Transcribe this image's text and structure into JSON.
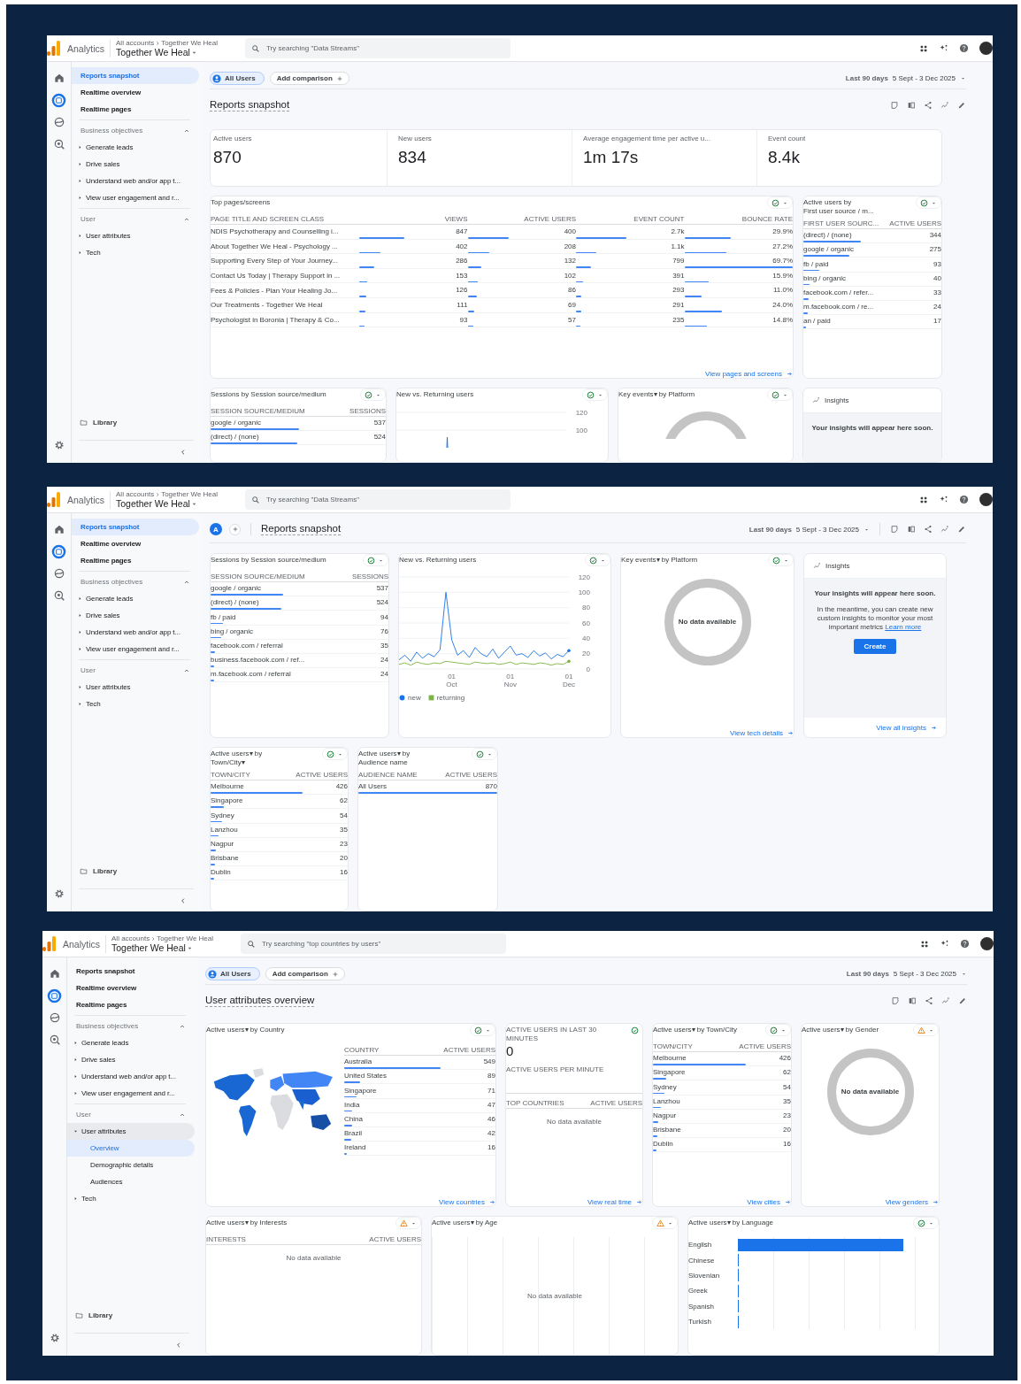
{
  "screens": [
    {
      "topbar": {
        "product": "Analytics",
        "breadcrumb": [
          "All accounts",
          "Together We Heal"
        ],
        "property": "Together We Heal",
        "search_placeholder": "Try searching \"Data Streams\""
      },
      "rail": [
        {
          "kind": "home",
          "selected": false
        },
        {
          "kind": "reports",
          "selected": true
        },
        {
          "kind": "explore",
          "selected": false
        },
        {
          "kind": "advertising",
          "selected": false
        }
      ],
      "nav": {
        "items": [
          {
            "label": "Reports snapshot",
            "selected": true
          },
          {
            "label": "Realtime overview",
            "selected": false
          },
          {
            "label": "Realtime pages",
            "selected": false
          }
        ],
        "sections": [
          {
            "title": "Business objectives",
            "expanded": true,
            "items": [
              {
                "label": "Generate leads",
                "expanded": false
              },
              {
                "label": "Drive sales",
                "expanded": false
              },
              {
                "label": "Understand web and/or app t...",
                "expanded": false
              },
              {
                "label": "View user engagement and r...",
                "expanded": false
              }
            ]
          },
          {
            "title": "User",
            "expanded": true,
            "items": [
              {
                "label": "User attributes",
                "expanded": false
              },
              {
                "label": "Tech",
                "expanded": false
              }
            ]
          }
        ],
        "library": "Library"
      },
      "header": {
        "kind": "full",
        "segment": "All Users",
        "comparison": "Add comparison",
        "title": "Reports snapshot",
        "date_label": "Last 90 days",
        "date_range": "5 Sept - 3 Dec 2025"
      },
      "rows": [
        {
          "cards": [
            {
              "kind": "kpis",
              "metrics": [
                {
                  "label": "Active users",
                  "value": "870"
                },
                {
                  "label": "New users",
                  "value": "834"
                },
                {
                  "label": "Average engagement time per active u...",
                  "value": "1m 17s"
                },
                {
                  "label": "Event count",
                  "value": "8.4k"
                }
              ]
            }
          ]
        },
        {
          "cards": [
            {
              "kind": "table",
              "title": "Top pages/screens",
              "status": {
                "kind": "ok",
                "menu": true
              },
              "columns": [
                "PAGE TITLE AND SCREEN CLASS",
                "VIEWS",
                "ACTIVE USERS",
                "EVENT COUNT",
                "BOUNCE RATE"
              ],
              "rows": [
                [
                  "NDIS Psychotherapy and Counselling i...",
                  "847",
                  "400",
                  "2.7k",
                  "29.9%"
                ],
                [
                  "About Together We Heal - Psychology ...",
                  "402",
                  "208",
                  "1.1k",
                  "27.2%"
                ],
                [
                  "Supporting Every Step of Your Journey...",
                  "286",
                  "132",
                  "799",
                  "69.7%"
                ],
                [
                  "Contact Us Today | Therapy Support in ...",
                  "153",
                  "102",
                  "391",
                  "15.9%"
                ],
                [
                  "Fees & Policies - Plan Your Healing Jo...",
                  "126",
                  "86",
                  "293",
                  "11.0%"
                ],
                [
                  "Our Treatments - Together We Heal",
                  "111",
                  "69",
                  "291",
                  "24.0%"
                ],
                [
                  "Psychologist in Boronia | Therapy & Co...",
                  "93",
                  "57",
                  "235",
                  "14.8%"
                ]
              ],
              "link": "View pages and screens"
            },
            {
              "kind": "table",
              "title": "Active users by\nFirst user source / m...",
              "status": {
                "kind": "ok",
                "menu": true
              },
              "columns": [
                "FIRST USER SOURC...",
                "ACTIVE USERS"
              ],
              "rows": [
                [
                  "(direct) / (none)",
                  "344"
                ],
                [
                  "google / organic",
                  "275"
                ],
                [
                  "fb / paid",
                  "93"
                ],
                [
                  "bing / organic",
                  "40"
                ],
                [
                  "facebook.com / refer...",
                  "33"
                ],
                [
                  "m.facebook.com / re...",
                  "24"
                ],
                [
                  "an / paid",
                  "17"
                ]
              ]
            }
          ]
        },
        {
          "cards": [
            {
              "kind": "table",
              "title": "Sessions by Session source/medium",
              "status": {
                "kind": "ok",
                "menu": true
              },
              "columns": [
                "SESSION SOURCE/MEDIUM",
                "SESSIONS"
              ],
              "rows": [
                [
                  "google / organic",
                  "537"
                ],
                [
                  "(direct) / (none)",
                  "524"
                ]
              ]
            },
            {
              "kind": "line_partial",
              "title": "New vs. Returning users",
              "status": {
                "kind": "ok",
                "menu": true
              },
              "y_ticks": [
                "120",
                "100"
              ]
            },
            {
              "kind": "donut",
              "title": "Key events▾ by Platform",
              "status": {
                "kind": "ok",
                "menu": true
              }
            },
            {
              "kind": "insights",
              "title": "Insights",
              "headline": "Your insights will appear here soon."
            }
          ]
        }
      ]
    },
    {
      "topbar": {
        "product": "Analytics",
        "breadcrumb": [
          "All accounts",
          "Together We Heal"
        ],
        "property": "Together We Heal",
        "search_placeholder": "Try searching \"Data Streams\""
      },
      "rail": [
        {
          "kind": "home",
          "selected": false
        },
        {
          "kind": "reports",
          "selected": true
        },
        {
          "kind": "explore",
          "selected": false
        },
        {
          "kind": "advertising",
          "selected": false
        }
      ],
      "nav": {
        "items": [
          {
            "label": "Reports snapshot",
            "selected": true
          },
          {
            "label": "Realtime overview",
            "selected": false
          },
          {
            "label": "Realtime pages",
            "selected": false
          }
        ],
        "sections": [
          {
            "title": "Business objectives",
            "expanded": true,
            "items": [
              {
                "label": "Generate leads",
                "expanded": false
              },
              {
                "label": "Drive sales",
                "expanded": false
              },
              {
                "label": "Understand web and/or app t...",
                "expanded": false
              },
              {
                "label": "View user engagement and r...",
                "expanded": false
              }
            ]
          },
          {
            "title": "User",
            "expanded": true,
            "items": [
              {
                "label": "User attributes",
                "expanded": false
              },
              {
                "label": "Tech",
                "expanded": false
              }
            ]
          }
        ],
        "library": "Library"
      },
      "header": {
        "kind": "compact",
        "segment_badge": "A",
        "title": "Reports snapshot",
        "date_label": "Last 90 days",
        "date_range": "5 Sept - 3 Dec 2025"
      },
      "rows": [
        {
          "cards": [
            {
              "kind": "table",
              "title": "Sessions by Session source/medium",
              "status": {
                "kind": "ok",
                "menu": true
              },
              "columns": [
                "SESSION SOURCE/MEDIUM",
                "SESSIONS"
              ],
              "rows": [
                [
                  "google / organic",
                  "537"
                ],
                [
                  "(direct) / (none)",
                  "524"
                ],
                [
                  "fb / paid",
                  "94"
                ],
                [
                  "bing / organic",
                  "76"
                ],
                [
                  "facebook.com / referral",
                  "35"
                ],
                [
                  "business.facebook.com / ref...",
                  "24"
                ],
                [
                  "m.facebook.com / referral",
                  "24"
                ]
              ]
            },
            {
              "kind": "line_chart",
              "title": "New vs. Returning users",
              "status": {
                "kind": "ok",
                "menu": true
              },
              "chart_data": {
                "type": "line",
                "categories": [
                  null,
                  null,
                  null,
                  null,
                  null,
                  null,
                  null,
                  null,
                  null,
                  "01 Oct",
                  null,
                  null,
                  null,
                  null,
                  null,
                  null,
                  null,
                  null,
                  null,
                  "01 Nov",
                  null,
                  null,
                  null,
                  null,
                  null,
                  null,
                  null,
                  null,
                  null,
                  "01 Dec"
                ],
                "ylim": [
                  0,
                  120
                ],
                "yticks": [
                  0,
                  20,
                  40,
                  60,
                  80,
                  100,
                  120
                ],
                "grid": true,
                "series": [
                  {
                    "name": "new",
                    "color": "#1a73e8",
                    "values": [
                      12,
                      18,
                      10,
                      22,
                      14,
                      20,
                      16,
                      25,
                      100,
                      38,
                      18,
                      24,
                      15,
                      28,
                      20,
                      16,
                      26,
                      14,
                      22,
                      30,
                      18,
                      20,
                      15,
                      24,
                      17,
                      21,
                      13,
                      19,
                      16,
                      24
                    ]
                  },
                  {
                    "name": "returning",
                    "color": "#7cb342",
                    "values": [
                      6,
                      8,
                      5,
                      9,
                      7,
                      6,
                      8,
                      7,
                      10,
                      9,
                      8,
                      7,
                      6,
                      9,
                      8,
                      7,
                      8,
                      6,
                      7,
                      9,
                      6,
                      8,
                      7,
                      6,
                      8,
                      7,
                      5,
                      7,
                      6,
                      10
                    ]
                  }
                ]
              }
            },
            {
              "kind": "donut",
              "title": "Key events▾ by Platform",
              "status": {
                "kind": "ok",
                "menu": true
              },
              "empty_text": "No data available",
              "link": "View tech details"
            },
            {
              "kind": "insights",
              "title": "Insights",
              "headline": "Your insights will appear here soon.",
              "body": "In the meantime, you can create new custom insights to monitor your most important metrics",
              "learn_more": "Learn more",
              "button": "Create",
              "link": "View all insights"
            }
          ]
        },
        {
          "cards": [
            {
              "kind": "table",
              "title": "Active users▾ by\nTown/City▾",
              "status": {
                "kind": "ok",
                "menu": true
              },
              "columns": [
                "TOWN/CITY",
                "ACTIVE USERS"
              ],
              "rows": [
                [
                  "Melbourne",
                  "426"
                ],
                [
                  "Singapore",
                  "62"
                ],
                [
                  "Sydney",
                  "54"
                ],
                [
                  "Lanzhou",
                  "35"
                ],
                [
                  "Nagpur",
                  "23"
                ],
                [
                  "Brisbane",
                  "20"
                ],
                [
                  "Dublin",
                  "16"
                ]
              ]
            },
            {
              "kind": "table",
              "title": "Active users▾ by\nAudience name",
              "status": {
                "kind": "ok",
                "menu": true
              },
              "columns": [
                "AUDIENCE NAME",
                "ACTIVE USERS"
              ],
              "rows": [
                [
                  "All Users",
                  "870"
                ]
              ]
            }
          ]
        }
      ]
    },
    {
      "topbar": {
        "product": "Analytics",
        "breadcrumb": [
          "All accounts",
          "Together We Heal"
        ],
        "property": "Together We Heal",
        "search_placeholder": "Try searching \"top countries by users\""
      },
      "rail": [
        {
          "kind": "home",
          "selected": false
        },
        {
          "kind": "reports",
          "selected": true
        },
        {
          "kind": "explore",
          "selected": false
        },
        {
          "kind": "advertising",
          "selected": false
        }
      ],
      "nav": {
        "items": [
          {
            "label": "Reports snapshot",
            "selected": false
          },
          {
            "label": "Realtime overview",
            "selected": false
          },
          {
            "label": "Realtime pages",
            "selected": false
          }
        ],
        "sections": [
          {
            "title": "Business objectives",
            "expanded": true,
            "items": [
              {
                "label": "Generate leads",
                "expanded": false
              },
              {
                "label": "Drive sales",
                "expanded": false
              },
              {
                "label": "Understand web and/or app t...",
                "expanded": false
              },
              {
                "label": "View user engagement and r...",
                "expanded": false
              }
            ]
          },
          {
            "title": "User",
            "expanded": true,
            "items": [
              {
                "label": "User attributes",
                "expanded": true,
                "children": [
                  {
                    "label": "Overview",
                    "selected": true
                  },
                  {
                    "label": "Demographic details",
                    "selected": false
                  },
                  {
                    "label": "Audiences",
                    "selected": false
                  }
                ]
              },
              {
                "label": "Tech",
                "expanded": false
              }
            ]
          }
        ],
        "library": "Library"
      },
      "header": {
        "kind": "full",
        "segment": "All Users",
        "comparison": "Add comparison",
        "title": "User attributes overview",
        "date_label": "Last 90 days",
        "date_range": "5 Sept - 3 Dec 2025"
      },
      "rows": [
        {
          "cards": [
            {
              "kind": "map_table",
              "title": "Active users▾ by Country",
              "status": {
                "kind": "ok",
                "menu": true
              },
              "columns": [
                "COUNTRY",
                "ACTIVE USERS"
              ],
              "rows": [
                [
                  "Australia",
                  "549"
                ],
                [
                  "United States",
                  "89"
                ],
                [
                  "Singapore",
                  "71"
                ],
                [
                  "India",
                  "47"
                ],
                [
                  "China",
                  "46"
                ],
                [
                  "Brazil",
                  "42"
                ],
                [
                  "Ireland",
                  "16"
                ]
              ],
              "link": "View countries"
            },
            {
              "kind": "realtime",
              "title": "ACTIVE USERS IN LAST 30 MINUTES",
              "status": {
                "kind": "ok",
                "menu": false
              },
              "value": "0",
              "per_minute_label": "ACTIVE USERS PER MINUTE",
              "columns": [
                "TOP COUNTRIES",
                "ACTIVE USERS"
              ],
              "empty_text": "No data available",
              "link": "View real time"
            },
            {
              "kind": "table",
              "title": "Active users▾ by Town/City",
              "status": {
                "kind": "ok",
                "menu": true
              },
              "columns": [
                "TOWN/CITY",
                "ACTIVE USERS"
              ],
              "rows": [
                [
                  "Melbourne",
                  "426"
                ],
                [
                  "Singapore",
                  "62"
                ],
                [
                  "Sydney",
                  "54"
                ],
                [
                  "Lanzhou",
                  "35"
                ],
                [
                  "Nagpur",
                  "23"
                ],
                [
                  "Brisbane",
                  "20"
                ],
                [
                  "Dublin",
                  "16"
                ]
              ],
              "link": "View cities"
            },
            {
              "kind": "donut",
              "title": "Active users▾ by Gender",
              "status": {
                "kind": "warning",
                "menu": true
              },
              "empty_text": "No data available",
              "link": "View genders"
            }
          ]
        },
        {
          "cards": [
            {
              "kind": "table",
              "title": "Active users▾ by Interests",
              "status": {
                "kind": "warning",
                "menu": true
              },
              "columns": [
                "INTERESTS",
                "ACTIVE USERS"
              ],
              "empty_text": "No data available"
            },
            {
              "kind": "age",
              "title": "Active users▾ by Age",
              "status": {
                "kind": "warning",
                "menu": true
              },
              "empty_text": "No data available"
            },
            {
              "kind": "bar_list",
              "title": "Active users▾ by Language",
              "status": {
                "kind": "ok",
                "menu": true
              },
              "bars": [
                {
                  "label": "English",
                  "level": 0.86
                },
                {
                  "label": "Chinese",
                  "level": 0.005
                },
                {
                  "label": "Slovenian",
                  "level": 0.005
                },
                {
                  "label": "Greek",
                  "level": 0.005
                },
                {
                  "label": "Spanish",
                  "level": 0.005
                },
                {
                  "label": "Turkish",
                  "level": 0.005
                }
              ]
            }
          ]
        }
      ]
    }
  ]
}
